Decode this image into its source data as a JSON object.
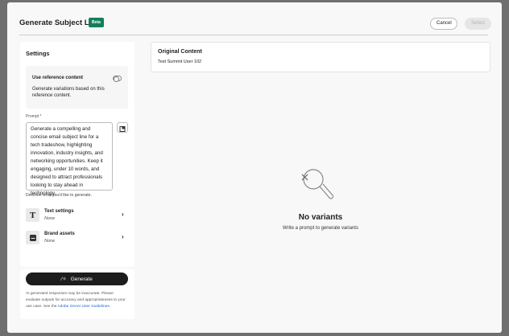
{
  "header": {
    "title": "Generate Subject Line",
    "badge": "Beta",
    "cancel": "Cancel",
    "select": "Select"
  },
  "settings": {
    "title": "Settings",
    "reference": {
      "label": "Use reference content",
      "description": "Generate variations based on this reference content.",
      "enabled": false
    },
    "prompt": {
      "label": "Prompt",
      "required_mark": "*",
      "value": "Generate a compelling and concise email subject line for a tech tradeshow, highlighting innovation, industry insights, and networking opportunities. Keep it engaging, under 10 words, and designed to attract professionals looking to stay ahead in technology.",
      "help": "Describe what you'd like to generate."
    },
    "text_settings": {
      "label": "Text settings",
      "value": "None"
    },
    "brand_assets": {
      "label": "Brand assets",
      "value": "None"
    },
    "generate": "Generate",
    "disclaimer": "AI generated responses may be inaccurate. Please evaluate outputs for accuracy and appropriateness to your use case. See the ",
    "disclaimer_link": "Adobe GenAI User Guidelines",
    "disclaimer_end": "."
  },
  "original": {
    "title": "Original Content",
    "value": "Test Summit User 102"
  },
  "empty": {
    "title": "No variants",
    "subtitle": "Write a prompt to generate variants"
  }
}
